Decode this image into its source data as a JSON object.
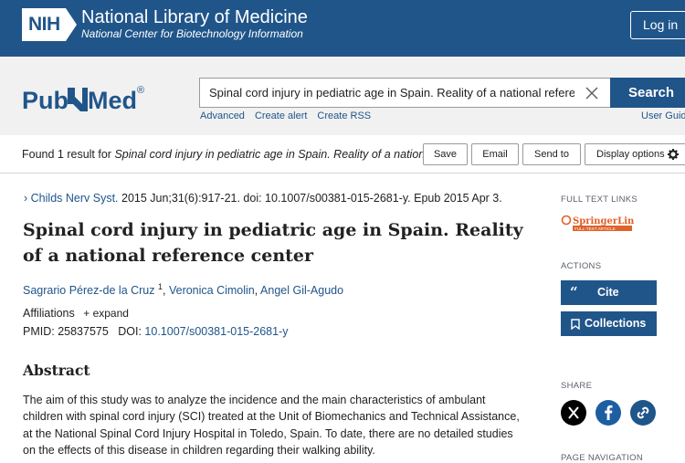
{
  "header": {
    "nih_logo_text": "NIH",
    "org_name": "National Library of Medicine",
    "org_subtitle": "National Center for Biotechnology Information",
    "login_label": "Log in"
  },
  "search": {
    "logo_text_left": "Pub",
    "logo_text_right": "Med",
    "logo_reg": "®",
    "query_value": "Spinal cord injury in pediatric age in Spain. Reality of a national reference c",
    "button_label": "Search",
    "links": [
      "Advanced",
      "Create alert",
      "Create RSS"
    ],
    "user_guide_label": "User Guid"
  },
  "results_bar": {
    "found_prefix": "Found 1 result for ",
    "found_query": "Spinal cord injury in pediatric age in Spain. Reality of a nationa...",
    "save_label": "Save",
    "email_label": "Email",
    "send_to_label": "Send to",
    "display_options_label": "Display options"
  },
  "article": {
    "journal": "Childs Nerv Syst.",
    "citation": " 2015 Jun;31(6):917-21. doi: 10.1007/s00381-015-2681-y. Epub 2015 Apr 3.",
    "title": "Spinal cord injury in pediatric age in Spain. Reality of a national reference center",
    "authors": [
      {
        "name": "Sagrario Pérez-de la Cruz",
        "sup": "1"
      },
      {
        "name": "Veronica Cimolin",
        "sup": ""
      },
      {
        "name": "Angel Gil-Agudo",
        "sup": ""
      }
    ],
    "affiliations_label": "Affiliations",
    "expand_label": "+ expand",
    "pmid_label": "PMID: ",
    "pmid_value": "25837575",
    "doi_label": "DOI: ",
    "doi_value": "10.1007/s00381-015-2681-y",
    "abstract_heading": "Abstract",
    "abstract_text": "The aim of this study was to analyze the incidence and the main characteristics of ambulant children with spinal cord injury (SCI) treated at the Unit of Biomechanics and Technical Assistance, at the National Spinal Cord Injury Hospital in Toledo, Spain. To date, there are no detailed studies on the effects of this disease in children regarding their walking ability."
  },
  "sidebar": {
    "full_text_links_label": "FULL TEXT LINKS",
    "springer_name": "SpringerLink",
    "springer_tag": "FULL-TEXT ARTICLE",
    "actions_label": "ACTIONS",
    "cite_label": "Cite",
    "collections_label": "Collections",
    "share_label": "SHARE",
    "page_nav_label": "PAGE NAVIGATION"
  },
  "colors": {
    "nih_blue": "#20558a",
    "link_blue": "#20558a",
    "springer_orange": "#e0612a",
    "facebook_blue": "#1d5ea3"
  },
  "icons": [
    "clear-icon",
    "gear-icon",
    "chevron-right-icon",
    "quote-icon",
    "bookmark-icon",
    "x-icon",
    "facebook-icon",
    "link-icon"
  ]
}
